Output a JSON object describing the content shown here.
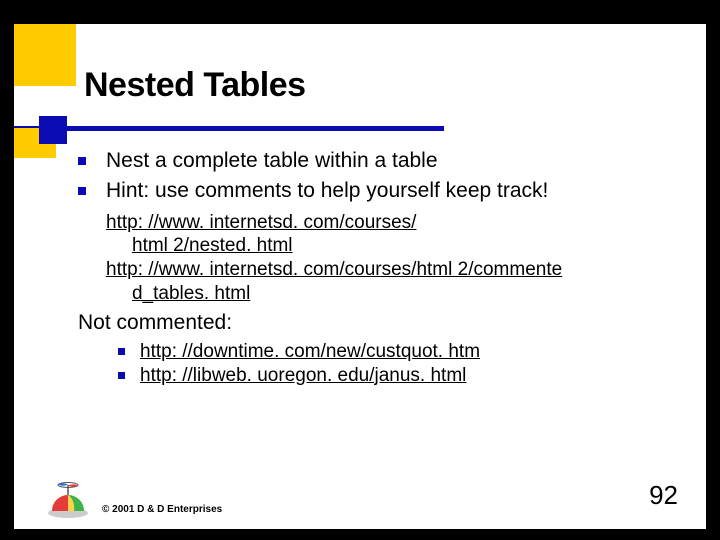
{
  "title": "Nested Tables",
  "bullets": {
    "b1": "Nest a complete table within a table",
    "b2": "Hint:  use comments to help yourself keep track!"
  },
  "url_block": {
    "u1a": "http: //www. internetsd. com/courses/",
    "u1b": "html 2/nested. html",
    "u2a": "http: //www. internetsd. com/courses/html 2/commente",
    "u2b": "d_tables. html"
  },
  "sub_heading": "Not commented:",
  "sub_urls": {
    "s1": "http: //downtime. com/new/custquot. htm",
    "s2": "http: //libweb. uoregon. edu/janus. html"
  },
  "slide_number": "92",
  "copyright": "© 2001 D & D Enterprises"
}
